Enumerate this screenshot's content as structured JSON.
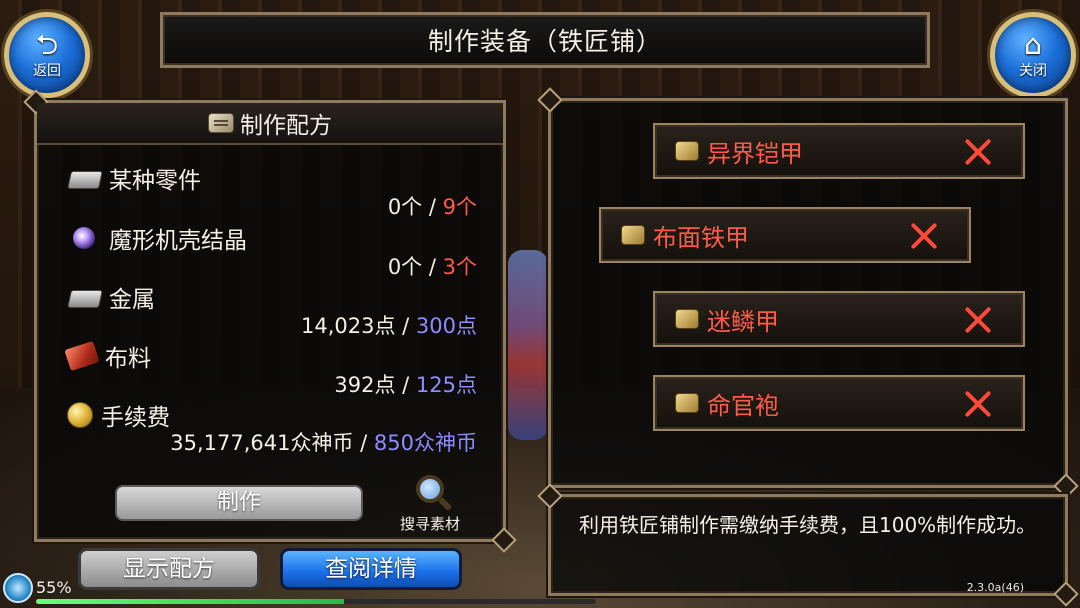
{
  "header": {
    "title": "制作装备（铁匠铺）",
    "back_label": "返回",
    "close_label": "关闭",
    "back_glyph": "⮌",
    "close_glyph": "⌂"
  },
  "recipe": {
    "header": "制作配方",
    "materials": [
      {
        "name": "某种零件",
        "icon": "ingot-icon",
        "have": "0个",
        "sep": " / ",
        "need": "9个",
        "need_color": "red"
      },
      {
        "name": "魔形机壳结晶",
        "icon": "crystal-icon",
        "have": "0个",
        "sep": " / ",
        "need": "3个",
        "need_color": "red"
      },
      {
        "name": "金属",
        "icon": "ingot-icon",
        "have": "14,023点",
        "sep": " / ",
        "need": "300点",
        "need_color": "blue"
      },
      {
        "name": "布料",
        "icon": "cloth-icon",
        "have": "392点",
        "sep": " / ",
        "need": "125点",
        "need_color": "blue"
      },
      {
        "name": "手续费",
        "icon": "coin-icon",
        "have": "35,177,641众神币",
        "sep": " / ",
        "need": "850众神币",
        "need_color": "blue"
      }
    ],
    "make_button": "制作",
    "search_label": "搜寻素材"
  },
  "bottom_buttons": {
    "show_recipe": "显示配方",
    "view_details": "查阅详情"
  },
  "equipment": {
    "items": [
      {
        "name": "异界铠甲"
      },
      {
        "name": "布面铁甲"
      },
      {
        "name": "迷鳞甲"
      },
      {
        "name": "命官袍"
      }
    ]
  },
  "description": "利用铁匠铺制作需缴纳手续费，且100%制作成功。",
  "status": {
    "progress_text": "55%",
    "progress_fraction": 0.55,
    "version": "2.3.0a(46)"
  },
  "colors": {
    "need_red": "#ff5a4a",
    "need_blue": "#8f8cff",
    "equip_name": "#ff5a4a",
    "accent_blue": "#1a6ee8"
  }
}
